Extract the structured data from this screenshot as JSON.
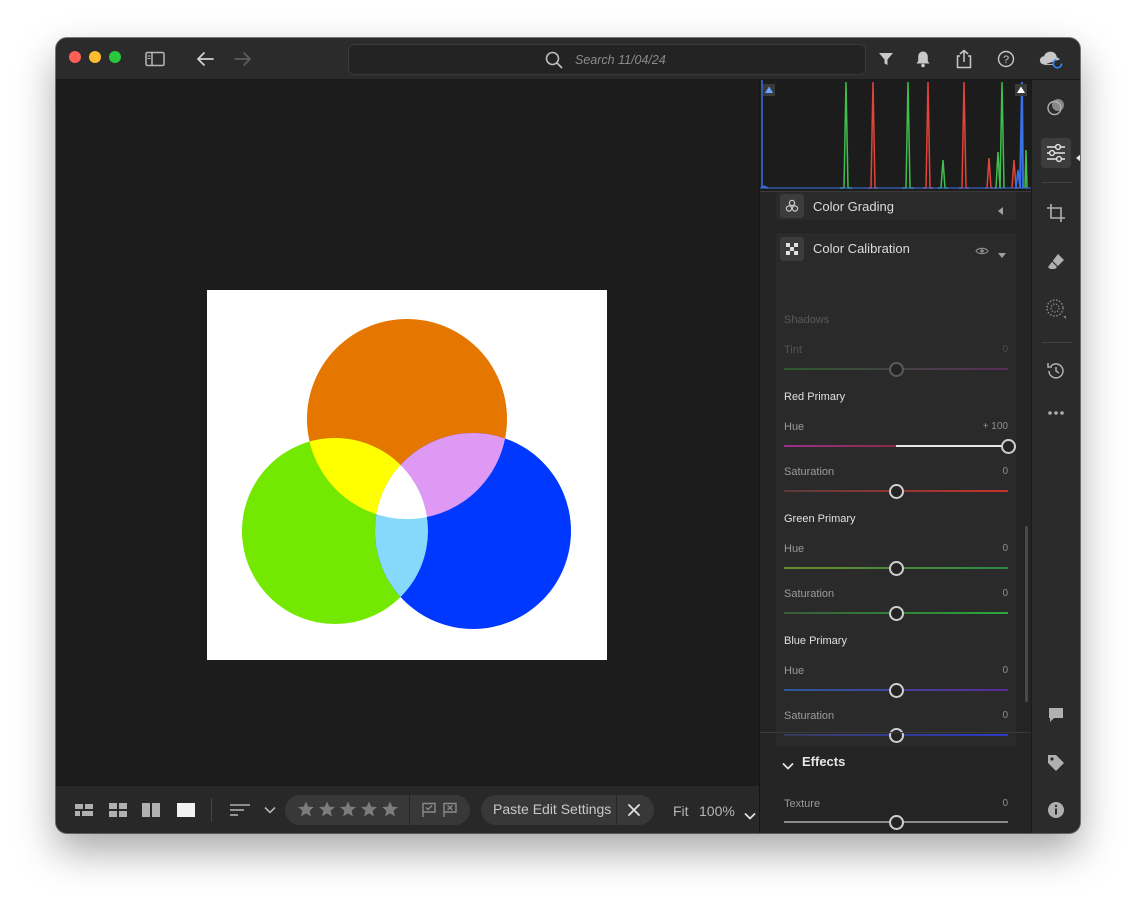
{
  "search": {
    "placeholder": "Search 11/04/24"
  },
  "panels": {
    "color_grading": {
      "title": "Color Grading"
    },
    "color_calibration": {
      "title": "Color Calibration",
      "shadows": {
        "heading": "Shadows",
        "tint_label": "Tint",
        "tint_value": "0"
      },
      "red_primary": {
        "heading": "Red Primary",
        "hue_label": "Hue",
        "hue_value": "+ 100",
        "sat_label": "Saturation",
        "sat_value": "0"
      },
      "green_primary": {
        "heading": "Green Primary",
        "hue_label": "Hue",
        "hue_value": "0",
        "sat_label": "Saturation",
        "sat_value": "0"
      },
      "blue_primary": {
        "heading": "Blue Primary",
        "hue_label": "Hue",
        "hue_value": "0",
        "sat_label": "Saturation",
        "sat_value": "0"
      }
    },
    "effects": {
      "title": "Effects",
      "texture_label": "Texture",
      "texture_value": "0"
    }
  },
  "bottom": {
    "paste_label": "Paste Edit Settings",
    "fit_label": "Fit",
    "zoom_value": "100%",
    "star_rating": 0
  },
  "slider_positions": {
    "shadows_tint": 0.5,
    "red_hue": 1.0,
    "red_saturation": 0.5,
    "green_hue": 0.5,
    "green_saturation": 0.5,
    "blue_hue": 0.5,
    "blue_saturation": 0.5,
    "texture": 0.5
  },
  "colors": {
    "photo_orange": "#e57700",
    "photo_green": "#73e800",
    "photo_blue": "#0038ff",
    "overlap_yellow": "#ffff00",
    "overlap_violet": "#dd99f3",
    "overlap_cyan": "#87d9fc",
    "histogram_red": "#e0443a",
    "histogram_green": "#3fbf4f",
    "histogram_blue": "#3a6fe6"
  }
}
